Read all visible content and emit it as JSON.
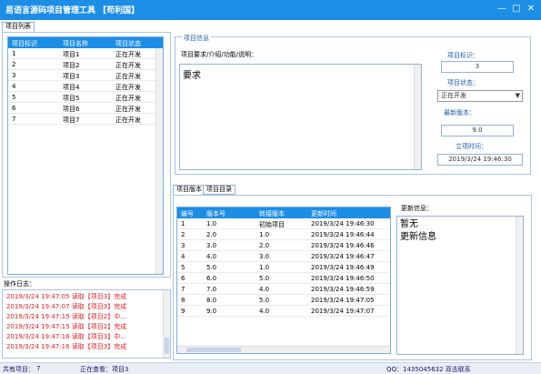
{
  "window": {
    "title": "易语言源码项目管理工具 【苟利国】",
    "controls": [
      "minimize-icon",
      "maximize-icon",
      "close-icon"
    ]
  },
  "project_list": {
    "tab_label": "项目列表",
    "columns": [
      "项目标识",
      "项目名称",
      "项目状态"
    ],
    "rows": [
      [
        "1",
        "项目1",
        "正在开发"
      ],
      [
        "2",
        "项目2",
        "正在开发"
      ],
      [
        "3",
        "项目3",
        "正在开发"
      ],
      [
        "4",
        "项目4",
        "正在开发"
      ],
      [
        "5",
        "项目5",
        "正在开发"
      ],
      [
        "6",
        "项目6",
        "正在开发"
      ],
      [
        "7",
        "项目7",
        "正在开发"
      ]
    ]
  },
  "log": {
    "label": "操作日志：",
    "lines": [
      "2019/3/24 19:47:05  读取【项目3】完成",
      "2019/3/24 19:47:07  读取【项目3】完成",
      "2019/3/24 19:47:15  读取【项目2】中...",
      "2019/3/24 19:47:15  读取【项目2】完成",
      "2019/3/24 19:47:16  读取【项目3】中...",
      "2019/3/24 19:47:16  读取【项目3】完成"
    ]
  },
  "project_info": {
    "group_label": "项目信息",
    "requirements_label": "项目要求/介绍/功能/说明：",
    "requirements_value": "要求",
    "id_label": "项目标识：",
    "id_value": "3",
    "status_label": "项目状态：",
    "status_value": "正在开发",
    "latest_version_label": "最新版本：",
    "latest_version_value": "9.0",
    "created_time_label": "立项时间：",
    "created_time_value": "2019/3/24 19:46:30"
  },
  "versions": {
    "tabs": [
      "项目版本",
      "项目目录"
    ],
    "columns": [
      "编号",
      "版本号",
      "转接版本",
      "更新时间"
    ],
    "rows": [
      [
        "1",
        "1.0",
        "初始项目",
        "2019/3/24 19:46:30"
      ],
      [
        "2",
        "2.0",
        "1.0",
        "2019/3/24 19:46:44"
      ],
      [
        "3",
        "3.0",
        "2.0",
        "2019/3/24 19:46:46"
      ],
      [
        "4",
        "4.0",
        "3.0",
        "2019/3/24 19:46:47"
      ],
      [
        "5",
        "5.0",
        "1.0",
        "2019/3/24 19:46:49"
      ],
      [
        "6",
        "6.0",
        "5.0",
        "2019/3/24 19:46:50"
      ],
      [
        "7",
        "7.0",
        "4.0",
        "2019/3/24 19:46:59"
      ],
      [
        "8",
        "8.0",
        "5.0",
        "2019/3/24 19:47:05"
      ],
      [
        "9",
        "9.0",
        "4.0",
        "2019/3/24 19:47:07"
      ]
    ],
    "update_info_label": "更新信息：",
    "update_info_lines": [
      "暂无",
      "更新信息"
    ]
  },
  "status_bar": {
    "total_label": "共有项目：",
    "total_value": "7",
    "viewing_label": "正在查看：项目3",
    "contact": "QQ：1435045632 双击联系"
  },
  "colors": {
    "accent": "#1c8ee6",
    "log_text": "#e02020"
  }
}
